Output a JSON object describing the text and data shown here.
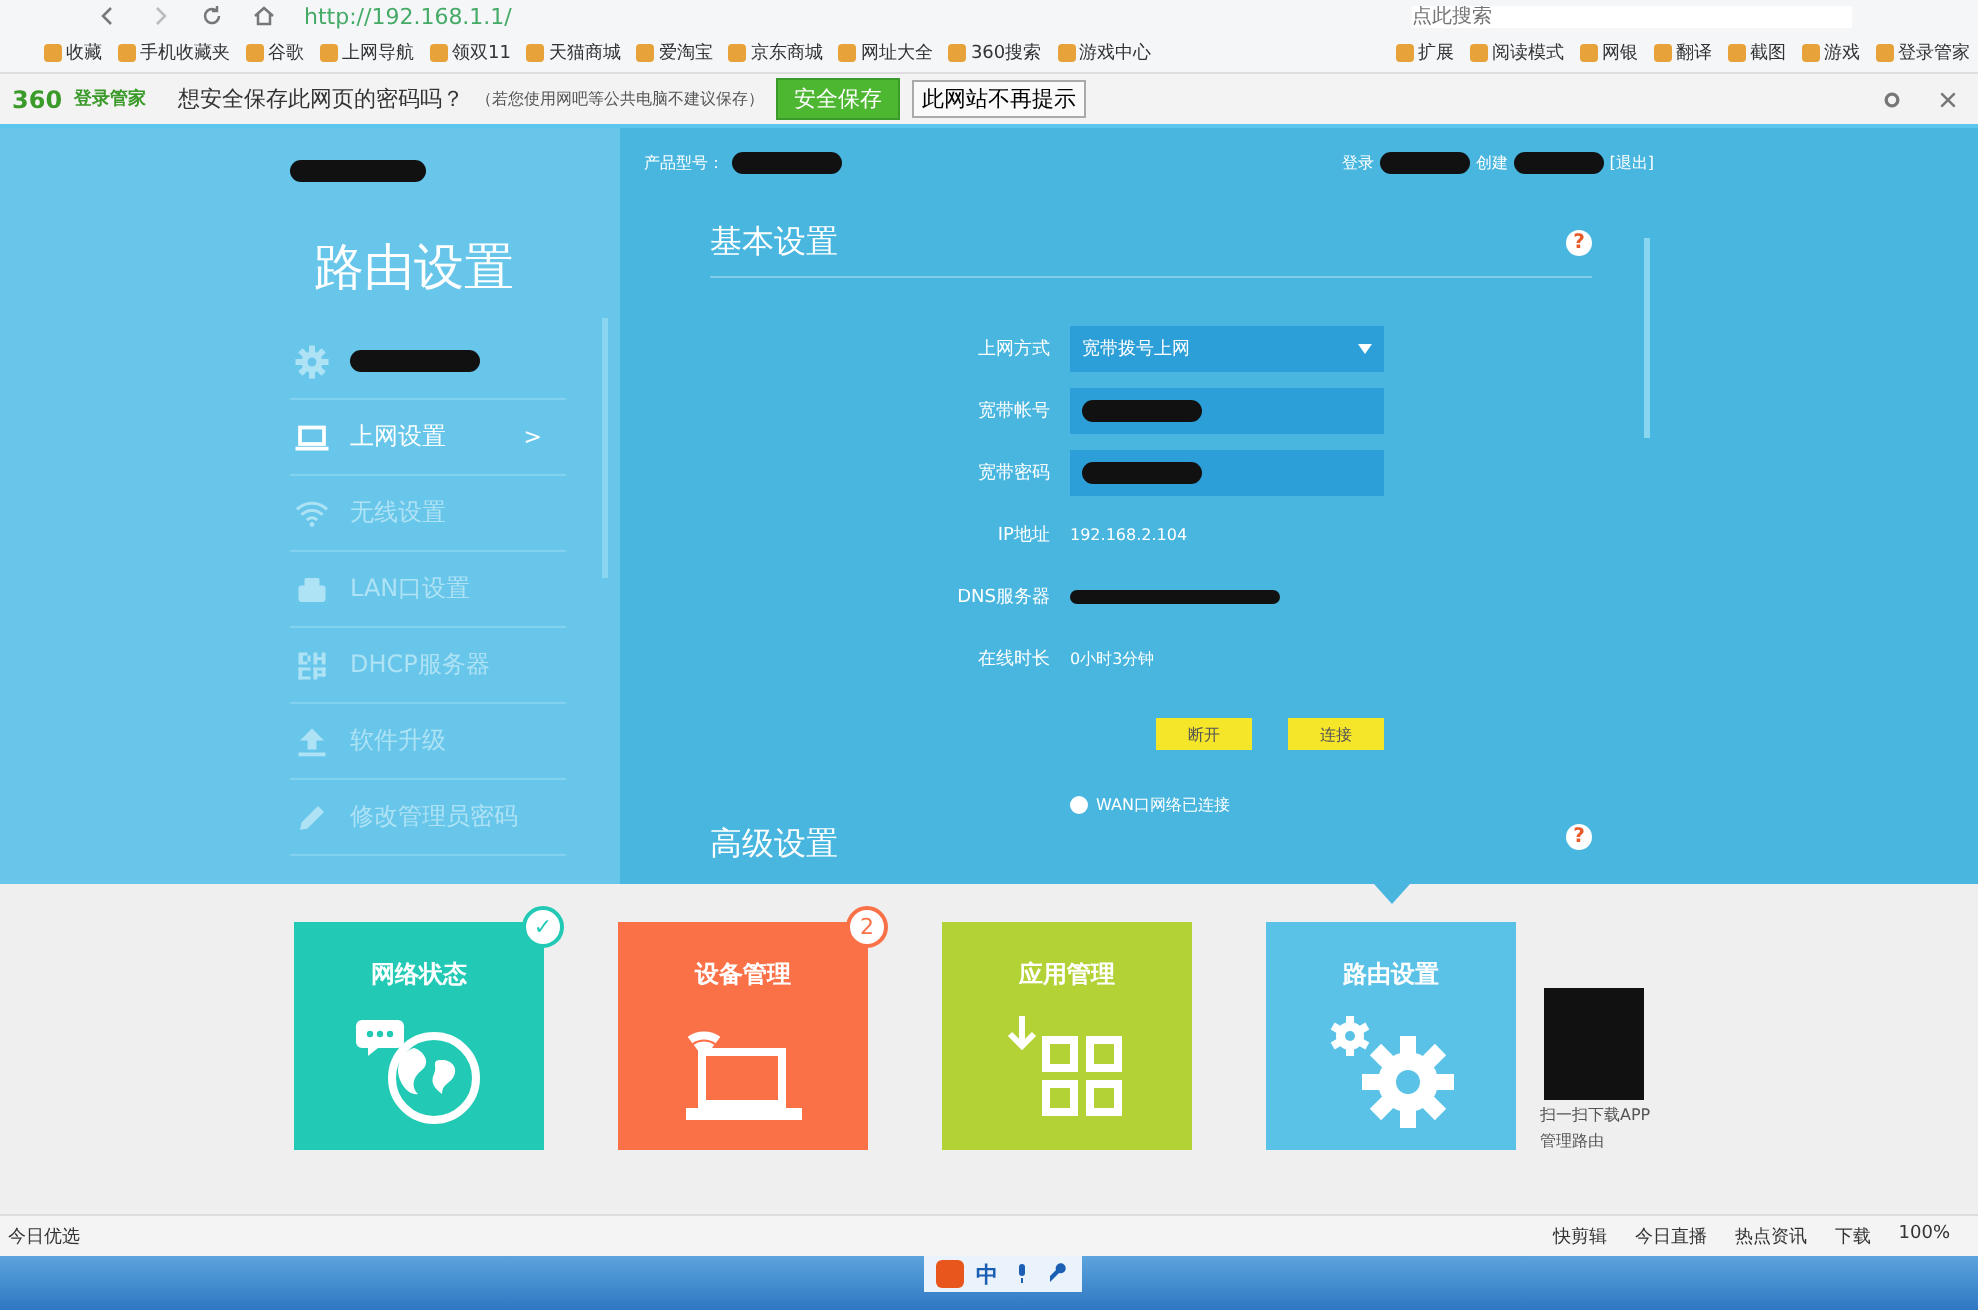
{
  "browser": {
    "url": "http://192.168.1.1/",
    "search_placeholder": "点此搜索"
  },
  "bookmarks": [
    {
      "label": "收藏"
    },
    {
      "label": "手机收藏夹"
    },
    {
      "label": "谷歌"
    },
    {
      "label": "上网导航"
    },
    {
      "label": "领双11"
    },
    {
      "label": "天猫商城"
    },
    {
      "label": "爱淘宝"
    },
    {
      "label": "京东商城"
    },
    {
      "label": "网址大全"
    },
    {
      "label": "360搜索"
    },
    {
      "label": "游戏中心"
    }
  ],
  "tools": [
    {
      "label": "扩展"
    },
    {
      "label": "阅读模式"
    },
    {
      "label": "网银"
    },
    {
      "label": "翻译"
    },
    {
      "label": "截图"
    },
    {
      "label": "游戏"
    },
    {
      "label": "登录管家"
    }
  ],
  "password_bar": {
    "brand": "360",
    "brand_sub": "登录管家",
    "prompt": "想安全保存此网页的密码吗？",
    "note": "（若您使用网吧等公共电脑不建议保存）",
    "save": "安全保存",
    "never": "此网站不再提示"
  },
  "router": {
    "title": "路由设置",
    "menu": [
      {
        "selected": false
      },
      {
        "label": "上网设置",
        "arrow": ">",
        "selected": true
      },
      {
        "label": "无线设置",
        "selected": false
      },
      {
        "label": "LAN口设置",
        "selected": false
      },
      {
        "label": "DHCP服务器",
        "selected": false
      },
      {
        "label": "软件升级",
        "selected": false
      },
      {
        "label": "修改管理员密码",
        "selected": false
      }
    ],
    "header": {
      "model_label": "产品型号：",
      "login": "登录",
      "create": "创建",
      "logout": "[退出]"
    },
    "basic": {
      "title": "基本设置",
      "help": "?",
      "fields": [
        {
          "label": "上网方式",
          "kind": "select",
          "value": "宽带拨号上网"
        },
        {
          "label": "宽带帐号",
          "kind": "input"
        },
        {
          "label": "宽带密码",
          "kind": "input"
        },
        {
          "label": "IP地址",
          "kind": "text",
          "value": "192.168.2.104"
        },
        {
          "label": "DNS服务器",
          "kind": "hidden"
        },
        {
          "label": "在线时长",
          "kind": "text",
          "value": "0小时3分钟"
        }
      ],
      "buttons": [
        "断开",
        "连接"
      ],
      "status": "WAN口网络已连接"
    },
    "advanced": {
      "title": "高级设置",
      "help": "?"
    }
  },
  "tiles": [
    {
      "label": "网络状态",
      "color": "#22c9b4",
      "badge": "✓",
      "selected": false
    },
    {
      "label": "设备管理",
      "color": "#fa7047",
      "badge": "2",
      "selected": false
    },
    {
      "label": "应用管理",
      "color": "#b3d236",
      "selected": false
    },
    {
      "label": "路由设置",
      "color": "#5bc2e7",
      "selected": true
    }
  ],
  "qr": {
    "caption": "扫一扫下载APP",
    "caption2": "管理路由"
  },
  "status_bar": {
    "left": "今日优选",
    "items": [
      "快剪辑",
      "今日直播",
      "热点资讯",
      "下载"
    ],
    "zoom": "100%"
  },
  "taskbar": {
    "ime": "中"
  }
}
